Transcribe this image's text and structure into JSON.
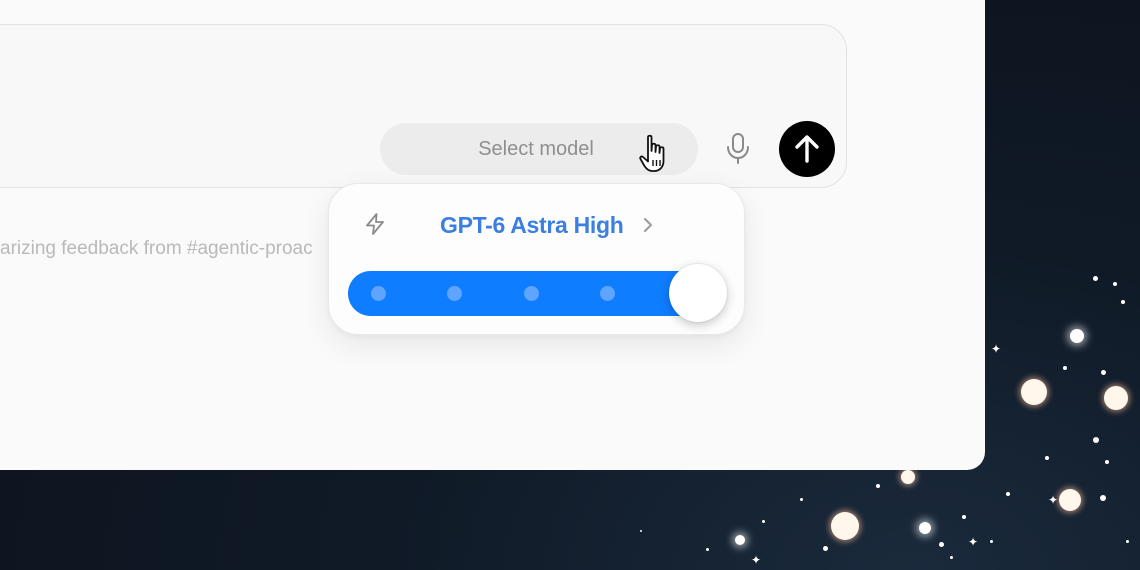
{
  "composer": {
    "model_select_label": "Select model"
  },
  "background_suggestion": "arizing feedback from #agentic-proac",
  "model_popover": {
    "model_name": "GPT-6 Astra High",
    "effort_level": {
      "selected_step": 5,
      "total_steps": 5,
      "fill_fraction": 1.0
    }
  },
  "icons": {
    "cursor": "hand-pointer-icon",
    "mic": "microphone-icon",
    "send": "arrow-up-icon",
    "bolt": "lightning-bolt-icon",
    "chevron": "chevron-right-icon"
  },
  "colors": {
    "accent_blue": "#0f7dff",
    "model_name_blue": "#3b7fe0",
    "send_button": "#000000"
  }
}
